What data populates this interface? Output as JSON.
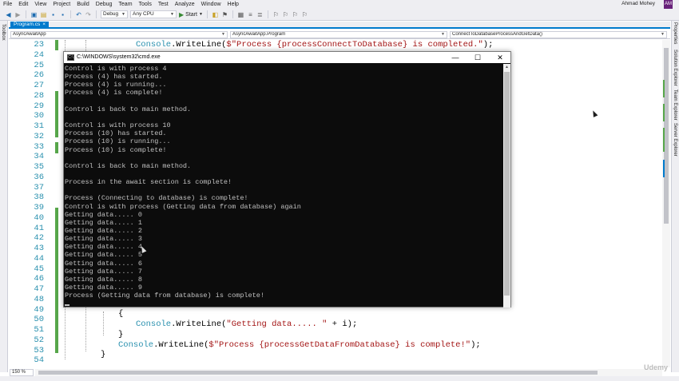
{
  "menu": {
    "items": [
      "File",
      "Edit",
      "View",
      "Project",
      "Build",
      "Debug",
      "Team",
      "Tools",
      "Test",
      "Analyze",
      "Window",
      "Help"
    ],
    "user": "Ahmad Mohey",
    "avatar": "AM"
  },
  "toolbar": {
    "configuration": "Debug",
    "platform": "Any CPU",
    "start_label": "Start"
  },
  "side_panels": {
    "left": "Toolbox",
    "right": [
      "Properties",
      "Solution Explorer",
      "Team Explorer",
      "Server Explorer"
    ]
  },
  "document": {
    "tab_label": "Program.cs",
    "tab_close": "×",
    "nav": {
      "project": "AsyncAwaitApp",
      "class": "AsyncAwaitApp.Program",
      "member": "ConnectToDatabaseProcessAndGetData()"
    }
  },
  "editor": {
    "line_numbers": [
      "23",
      "24",
      "25",
      "26",
      "27",
      "28",
      "29",
      "30",
      "31",
      "32",
      "33",
      "34",
      "35",
      "36",
      "37",
      "38",
      "39",
      "40",
      "41",
      "42",
      "43",
      "44",
      "45",
      "46",
      "47",
      "48",
      "49",
      "50",
      "51",
      "52",
      "53",
      "54"
    ],
    "code": {
      "line23_cls": "Console",
      "line23_mid": ".WriteLine(",
      "line23_str": "$\"Process {processConnectToDatabase} is completed.\"",
      "line23_end": ");",
      "line49": "{",
      "line50_cls": "Console",
      "line50_mid": ".WriteLine(",
      "line50_str": "\"Getting data..... \"",
      "line50_end": " + i);",
      "line51": "}",
      "line52_cls": "Console",
      "line52_mid": ".WriteLine(",
      "line52_str": "$\"Process {processGetDataFromDatabase} is complete!\"",
      "line52_end": ");",
      "line53": "}"
    },
    "zoom": "150 %"
  },
  "console": {
    "title": "C:\\WINDOWS\\system32\\cmd.exe",
    "icon": "C:\\",
    "lines": [
      "Control is with process 4",
      "Process (4) has started.",
      "Process (4) is running...",
      "Process (4) is complete!",
      "",
      "Control is back to main method.",
      "",
      "Control is with process 10",
      "Process (10) has started.",
      "Process (10) is running...",
      "Process (10) is complete!",
      "",
      "Control is back to main method.",
      "",
      "Process in the await section is complete!",
      "",
      "Process (Connecting to database) is complete!",
      "Control is with process (Getting data from database) again",
      "Getting data..... 0",
      "Getting data..... 1",
      "Getting data..... 2",
      "Getting data..... 3",
      "Getting data..... 4",
      "Getting data..... 5",
      "Getting data..... 6",
      "Getting data..... 7",
      "Getting data..... 8",
      "Getting data..... 9",
      "Process (Getting data from database) is complete!"
    ],
    "buttons": {
      "minimize": "—",
      "maximize": "☐",
      "close": "✕"
    }
  },
  "watermark": "Udemy",
  "colors": {
    "accent": "#007acc",
    "line_number": "#2b91af",
    "string": "#a31515",
    "change_bar": "#57a64a",
    "console_bg": "#0c0c0c",
    "console_text": "#c0c0c0"
  }
}
